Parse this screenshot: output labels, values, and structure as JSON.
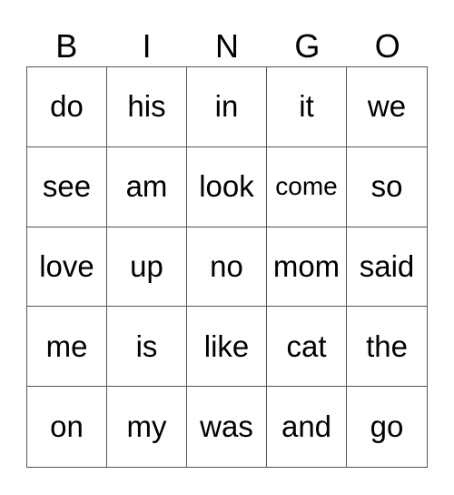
{
  "header": [
    "B",
    "I",
    "N",
    "G",
    "O"
  ],
  "rows": [
    [
      "do",
      "his",
      "in",
      "it",
      "we"
    ],
    [
      "see",
      "am",
      "look",
      "come",
      "so"
    ],
    [
      "love",
      "up",
      "no",
      "mom",
      "said"
    ],
    [
      "me",
      "is",
      "like",
      "cat",
      "the"
    ],
    [
      "on",
      "my",
      "was",
      "and",
      "go"
    ]
  ]
}
